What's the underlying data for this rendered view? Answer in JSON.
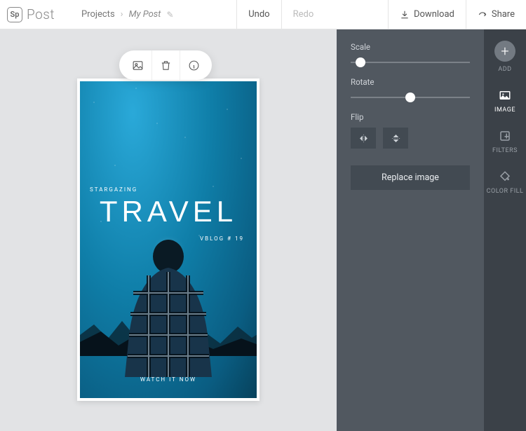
{
  "header": {
    "brand": "Post",
    "logo_text": "Sp",
    "breadcrumb_root": "Projects",
    "breadcrumb_current": "My Post",
    "undo": "Undo",
    "redo": "Redo",
    "download": "Download",
    "share": "Share"
  },
  "panel": {
    "scale_label": "Scale",
    "scale_position_pct": 8,
    "rotate_label": "Rotate",
    "rotate_position_pct": 50,
    "flip_label": "Flip",
    "replace_label": "Replace image"
  },
  "sidebar": {
    "add": "ADD",
    "image": "IMAGE",
    "filters": "FILTERS",
    "colorfill": "COLOR FILL"
  },
  "poster": {
    "super": "STARGAZING",
    "title": "TRAVEL",
    "vblog": "VBLOG # 19",
    "cta": "WATCH IT NOW"
  }
}
